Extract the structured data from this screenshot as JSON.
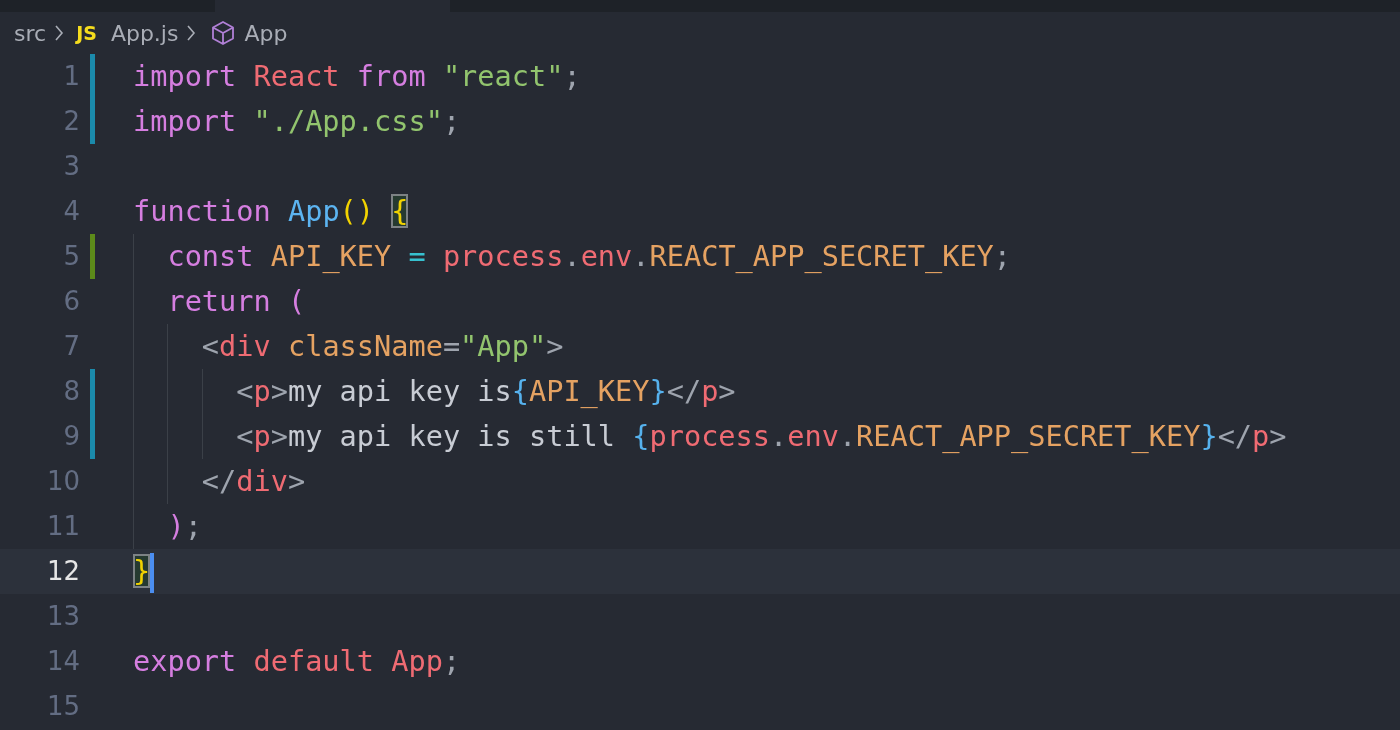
{
  "breadcrumbs": [
    {
      "kind": "folder",
      "label": "src"
    },
    {
      "kind": "file",
      "badge": "JS",
      "label": "App.js"
    },
    {
      "kind": "symbol",
      "label": "App"
    }
  ],
  "lines": [
    {
      "number": "1",
      "modified": true,
      "added": false,
      "current": false,
      "tokens": [
        {
          "t": "import",
          "kind": "keyword"
        },
        {
          "t": " React",
          "kind": "variable"
        },
        {
          "t": " from",
          "kind": "keyword"
        },
        {
          "t": " \"react\"",
          "kind": "string"
        },
        {
          "t": ";",
          "kind": "punct"
        }
      ]
    },
    {
      "number": "2",
      "modified": true,
      "added": false,
      "current": false,
      "tokens": [
        {
          "t": "import",
          "kind": "keyword"
        },
        {
          "t": " \"./App.css\"",
          "kind": "string"
        },
        {
          "t": ";",
          "kind": "punct"
        }
      ]
    },
    {
      "number": "3",
      "modified": false,
      "added": false,
      "current": false
    },
    {
      "number": "4",
      "modified": false,
      "added": false,
      "current": false,
      "tokens": [
        {
          "t": "function",
          "kind": "keyword"
        },
        {
          "t": " App",
          "kind": "function"
        },
        {
          "t": "() ",
          "kind": "bracket"
        },
        {
          "t": "{",
          "kind": "bracket",
          "match": true
        }
      ]
    },
    {
      "number": "5",
      "modified": false,
      "added": true,
      "current": false,
      "tokens": [
        {
          "t": "  const",
          "kind": "keyword"
        },
        {
          "t": " API_KEY",
          "kind": "constant"
        },
        {
          "t": " =",
          "kind": "operator"
        },
        {
          "t": " process",
          "kind": "variable"
        },
        {
          "t": ".",
          "kind": "punct"
        },
        {
          "t": "env",
          "kind": "variable"
        },
        {
          "t": ".",
          "kind": "punct"
        },
        {
          "t": "REACT_APP_SECRET_KEY",
          "kind": "constant"
        },
        {
          "t": ";",
          "kind": "punct"
        }
      ]
    },
    {
      "number": "6",
      "modified": false,
      "added": false,
      "current": false,
      "tokens": [
        {
          "t": "  return",
          "kind": "keyword"
        },
        {
          "t": " (",
          "kind": "keyword"
        }
      ]
    },
    {
      "number": "7",
      "modified": false,
      "added": false,
      "current": false,
      "tokens": [
        {
          "t": "    <",
          "kind": "punct"
        },
        {
          "t": "div",
          "kind": "variable"
        },
        {
          "t": " className",
          "kind": "constant"
        },
        {
          "t": "=",
          "kind": "punct"
        },
        {
          "t": "\"App\"",
          "kind": "string"
        },
        {
          "t": ">",
          "kind": "punct"
        }
      ]
    },
    {
      "number": "8",
      "modified": true,
      "added": false,
      "current": false,
      "tokens": [
        {
          "t": "      <",
          "kind": "punct"
        },
        {
          "t": "p",
          "kind": "variable"
        },
        {
          "t": ">",
          "kind": "punct"
        },
        {
          "t": "my api key is",
          "kind": "text"
        },
        {
          "t": "{",
          "kind": "jsx"
        },
        {
          "t": "API_KEY",
          "kind": "constant"
        },
        {
          "t": "}",
          "kind": "jsx"
        },
        {
          "t": "</",
          "kind": "punct"
        },
        {
          "t": "p",
          "kind": "variable"
        },
        {
          "t": ">",
          "kind": "punct"
        }
      ]
    },
    {
      "number": "9",
      "modified": true,
      "added": false,
      "current": false,
      "tokens": [
        {
          "t": "      <",
          "kind": "punct"
        },
        {
          "t": "p",
          "kind": "variable"
        },
        {
          "t": ">",
          "kind": "punct"
        },
        {
          "t": "my api key is still",
          "kind": "text"
        },
        {
          "t": " {",
          "kind": "jsx"
        },
        {
          "t": "process",
          "kind": "variable"
        },
        {
          "t": ".",
          "kind": "punct"
        },
        {
          "t": "env",
          "kind": "variable"
        },
        {
          "t": ".",
          "kind": "punct"
        },
        {
          "t": "REACT_APP_SECRET_KEY",
          "kind": "constant"
        },
        {
          "t": "}",
          "kind": "jsx"
        },
        {
          "t": "</",
          "kind": "punct"
        },
        {
          "t": "p",
          "kind": "variable"
        },
        {
          "t": ">",
          "kind": "punct"
        }
      ]
    },
    {
      "number": "10",
      "modified": false,
      "added": false,
      "current": false,
      "tokens": [
        {
          "t": "    </",
          "kind": "punct"
        },
        {
          "t": "div",
          "kind": "variable"
        },
        {
          "t": ">",
          "kind": "punct"
        }
      ]
    },
    {
      "number": "11",
      "modified": false,
      "added": false,
      "current": false,
      "tokens": [
        {
          "t": "  )",
          "kind": "keyword"
        },
        {
          "t": ";",
          "kind": "punct"
        }
      ]
    },
    {
      "number": "12",
      "modified": false,
      "added": false,
      "current": true,
      "tokens": [
        {
          "t": "}",
          "kind": "bracket",
          "match": true
        }
      ]
    },
    {
      "number": "13",
      "modified": false,
      "added": false,
      "current": false
    },
    {
      "number": "14",
      "modified": false,
      "added": false,
      "current": false,
      "tokens": [
        {
          "t": "export",
          "kind": "keyword"
        },
        {
          "t": " default",
          "kind": "variable"
        },
        {
          "t": " App",
          "kind": "variable"
        },
        {
          "t": ";",
          "kind": "punct"
        }
      ]
    },
    {
      "number": "15",
      "modified": false,
      "added": false,
      "current": false
    }
  ]
}
